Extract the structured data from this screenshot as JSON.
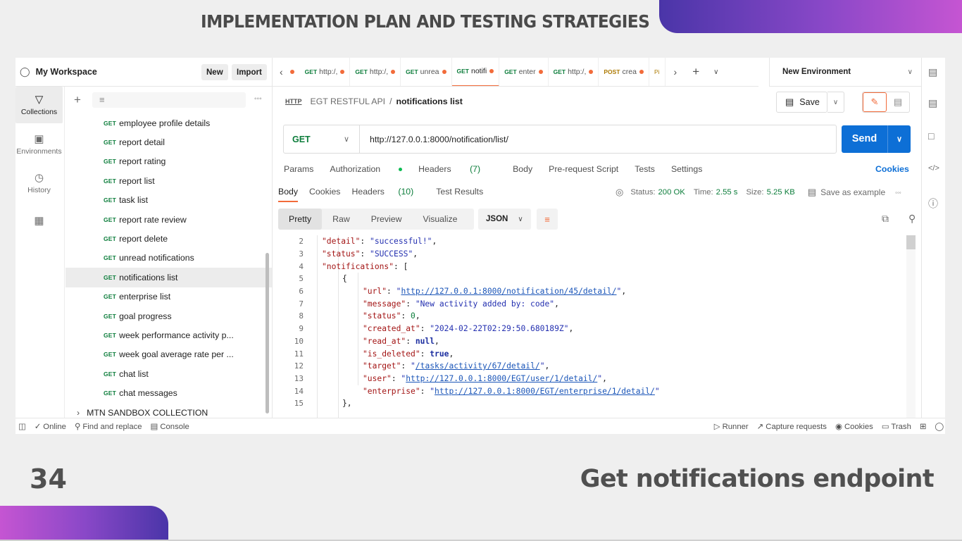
{
  "slide": {
    "title": "IMPLEMENTATION PLAN AND TESTING STRATEGIES",
    "page_number": "34",
    "caption": "Get notifications endpoint"
  },
  "workspace": {
    "title": "My Workspace",
    "new_label": "New",
    "import_label": "Import"
  },
  "rail": [
    {
      "label": "Collections",
      "icon": "collections-icon"
    },
    {
      "label": "Environments",
      "icon": "environments-icon"
    },
    {
      "label": "History",
      "icon": "history-icon"
    },
    {
      "label": "",
      "icon": "apps-icon"
    }
  ],
  "sidebar": {
    "method": "GET",
    "requests": [
      "employee profile details",
      "report detail",
      "report rating",
      "report list",
      "task list",
      "report rate review",
      "report delete",
      "unread notifications",
      "notifications list",
      "enterprise list",
      "goal progress",
      "week performance activity p...",
      "week goal average rate per ...",
      "chat list",
      "chat messages"
    ],
    "selected_index": 8,
    "collection": "MTN SANDBOX COLLECTION"
  },
  "tabs": [
    {
      "method": "GET",
      "label": "http:/,"
    },
    {
      "method": "GET",
      "label": "http:/,"
    },
    {
      "method": "GET",
      "label": "unrea"
    },
    {
      "method": "GET",
      "label": "notifi",
      "active": true
    },
    {
      "method": "GET",
      "label": "enter"
    },
    {
      "method": "GET",
      "label": "http:/,"
    },
    {
      "method": "POST",
      "label": "crea"
    },
    {
      "method": "",
      "label": "Pi"
    }
  ],
  "environment": "New Environment",
  "breadcrumb": {
    "collection": "EGT RESTFUL API",
    "sep": "/",
    "request": "notifications list"
  },
  "save_label": "Save",
  "request": {
    "method": "GET",
    "url": "http://127.0.0.1:8000/notification/list/",
    "send_label": "Send",
    "tabs": {
      "params": "Params",
      "authorization": "Authorization",
      "headers": "Headers",
      "headers_count": "(7)",
      "body": "Body",
      "prerequest": "Pre-request Script",
      "tests": "Tests",
      "settings": "Settings"
    },
    "cookies_label": "Cookies"
  },
  "response": {
    "tabs": {
      "body": "Body",
      "cookies": "Cookies",
      "headers": "Headers",
      "headers_count": "(10)",
      "test_results": "Test Results"
    },
    "status_label": "Status:",
    "status_value": "200 OK",
    "time_label": "Time:",
    "time_value": "2.55 s",
    "size_label": "Size:",
    "size_value": "5.25 KB",
    "save_example": "Save as example",
    "format_tabs": [
      "Pretty",
      "Raw",
      "Preview",
      "Visualize"
    ],
    "format": "JSON"
  },
  "code_lines": [
    {
      "n": "2",
      "indent": 1,
      "parts": [
        [
          "k",
          "\"detail\""
        ],
        [
          "p",
          ": "
        ],
        [
          "s",
          "\"successful!\""
        ],
        [
          "p",
          ","
        ]
      ]
    },
    {
      "n": "3",
      "indent": 1,
      "parts": [
        [
          "k",
          "\"status\""
        ],
        [
          "p",
          ": "
        ],
        [
          "s",
          "\"SUCCESS\""
        ],
        [
          "p",
          ","
        ]
      ]
    },
    {
      "n": "4",
      "indent": 1,
      "parts": [
        [
          "k",
          "\"notifications\""
        ],
        [
          "p",
          ": ["
        ]
      ]
    },
    {
      "n": "5",
      "indent": 2,
      "parts": [
        [
          "p",
          "{"
        ]
      ]
    },
    {
      "n": "6",
      "indent": 3,
      "parts": [
        [
          "k",
          "\"url\""
        ],
        [
          "p",
          ": "
        ],
        [
          "s",
          "\""
        ],
        [
          "u",
          "http://127.0.0.1:8000/notification/45/detail/"
        ],
        [
          "s",
          "\""
        ],
        [
          "p",
          ","
        ]
      ]
    },
    {
      "n": "7",
      "indent": 3,
      "parts": [
        [
          "k",
          "\"message\""
        ],
        [
          "p",
          ": "
        ],
        [
          "s",
          "\"New activity added by: code\""
        ],
        [
          "p",
          ","
        ]
      ]
    },
    {
      "n": "8",
      "indent": 3,
      "parts": [
        [
          "k",
          "\"status\""
        ],
        [
          "p",
          ": "
        ],
        [
          "n",
          "0"
        ],
        [
          "p",
          ","
        ]
      ]
    },
    {
      "n": "9",
      "indent": 3,
      "parts": [
        [
          "k",
          "\"created_at\""
        ],
        [
          "p",
          ": "
        ],
        [
          "s",
          "\"2024-02-22T02:29:50.680189Z\""
        ],
        [
          "p",
          ","
        ]
      ]
    },
    {
      "n": "10",
      "indent": 3,
      "parts": [
        [
          "k",
          "\"read_at\""
        ],
        [
          "p",
          ": "
        ],
        [
          "b",
          "null"
        ],
        [
          "p",
          ","
        ]
      ]
    },
    {
      "n": "11",
      "indent": 3,
      "parts": [
        [
          "k",
          "\"is_deleted\""
        ],
        [
          "p",
          ": "
        ],
        [
          "b",
          "true"
        ],
        [
          "p",
          ","
        ]
      ]
    },
    {
      "n": "12",
      "indent": 3,
      "parts": [
        [
          "k",
          "\"target\""
        ],
        [
          "p",
          ": "
        ],
        [
          "s",
          "\""
        ],
        [
          "u",
          "/tasks/activity/67/detail/"
        ],
        [
          "s",
          "\""
        ],
        [
          "p",
          ","
        ]
      ]
    },
    {
      "n": "13",
      "indent": 3,
      "parts": [
        [
          "k",
          "\"user\""
        ],
        [
          "p",
          ": "
        ],
        [
          "s",
          "\""
        ],
        [
          "u",
          "http://127.0.0.1:8000/EGT/user/1/detail/"
        ],
        [
          "s",
          "\""
        ],
        [
          "p",
          ","
        ]
      ]
    },
    {
      "n": "14",
      "indent": 3,
      "parts": [
        [
          "k",
          "\"enterprise\""
        ],
        [
          "p",
          ": "
        ],
        [
          "s",
          "\""
        ],
        [
          "u",
          "http://127.0.0.1:8000/EGT/enterprise/1/detail/"
        ],
        [
          "s",
          "\""
        ]
      ]
    },
    {
      "n": "15",
      "indent": 2,
      "parts": [
        [
          "p",
          "},"
        ]
      ]
    }
  ],
  "footer": {
    "online": "Online",
    "find_replace": "Find and replace",
    "console": "Console",
    "runner": "Runner",
    "capture": "Capture requests",
    "cookies": "Cookies",
    "trash": "Trash"
  }
}
